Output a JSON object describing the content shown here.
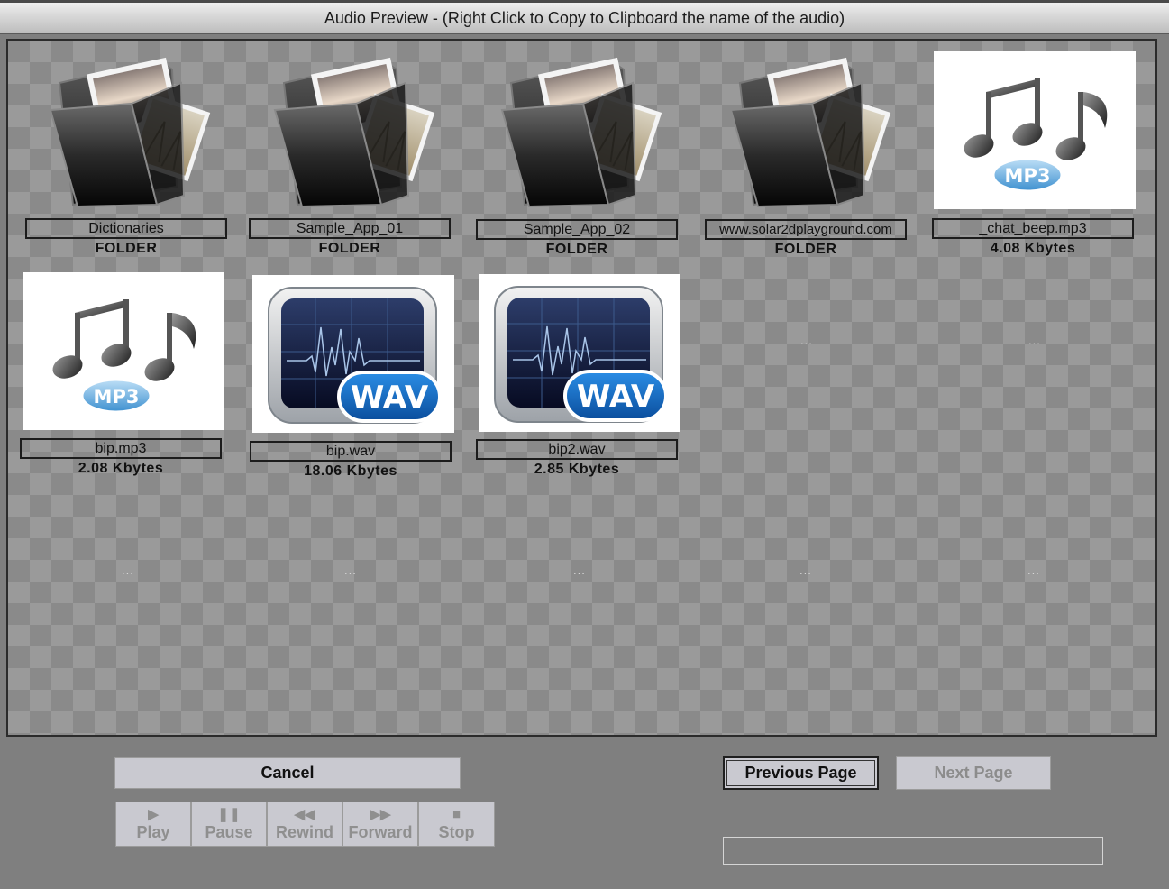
{
  "window": {
    "title": "Audio Preview - (Right Click to Copy to Clipboard the name of the audio)"
  },
  "items": [
    {
      "name": "Dictionaries",
      "info": "FOLDER",
      "icon": "folder-icon"
    },
    {
      "name": "Sample_App_01",
      "info": "FOLDER",
      "icon": "folder-icon"
    },
    {
      "name": "Sample_App_02",
      "info": "FOLDER",
      "icon": "folder-icon"
    },
    {
      "name": "www.solar2dplayground.com",
      "info": "FOLDER",
      "icon": "folder-icon"
    },
    {
      "name": "_chat_beep.mp3",
      "info": "4.08 Kbytes",
      "icon": "mp3-icon"
    },
    {
      "name": "bip.mp3",
      "info": "2.08 Kbytes",
      "icon": "mp3-icon"
    },
    {
      "name": "bip.wav",
      "info": "18.06 Kbytes",
      "icon": "wav-icon"
    },
    {
      "name": "bip2.wav",
      "info": "2.85 Kbytes",
      "icon": "wav-icon"
    }
  ],
  "empty_slot_text": "...",
  "buttons": {
    "cancel": "Cancel",
    "previous_page": "Previous Page",
    "next_page": "Next Page"
  },
  "media": {
    "play": {
      "label": "Play",
      "icon": "play-icon",
      "glyph": "▶"
    },
    "pause": {
      "label": "Pause",
      "icon": "pause-icon",
      "glyph": "❚❚"
    },
    "rewind": {
      "label": "Rewind",
      "icon": "rewind-icon",
      "glyph": "◀◀"
    },
    "forward": {
      "label": "Forward",
      "icon": "forward-icon",
      "glyph": "▶▶"
    },
    "stop": {
      "label": "Stop",
      "icon": "stop-icon",
      "glyph": "■"
    }
  },
  "status": {
    "text": ""
  },
  "colors": {
    "background": "#7f7f7f",
    "button_face": "#c9c9d0",
    "disabled_text": "#8c8c8c"
  }
}
